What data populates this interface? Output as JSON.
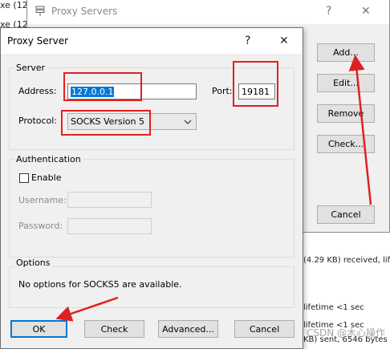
{
  "background": {
    "log_left": [
      "xe (12",
      "xe (12"
    ],
    "window": {
      "title": "Proxy Servers",
      "help": "?",
      "close": "✕",
      "buttons": {
        "add": "Add...",
        "edit": "Edit...",
        "remove": "Remove",
        "check": "Check...",
        "cancel": "Cancel"
      }
    },
    "log_right": [
      "(4.29 KB) received, lifet",
      "lifetime <1 sec",
      "lifetime <1 sec",
      "KB) sent, 6546 bytes (6"
    ]
  },
  "dialog": {
    "title": "Proxy Server",
    "help": "?",
    "close": "✕",
    "server": {
      "legend": "Server",
      "address_label": "Address:",
      "address_value": "127.0.0.1",
      "port_label": "Port:",
      "port_value": "19181",
      "protocol_label": "Protocol:",
      "protocol_value": "SOCKS Version 5"
    },
    "authentication": {
      "legend": "Authentication",
      "enable_label": "Enable",
      "enable_checked": false,
      "username_label": "Username:",
      "password_label": "Password:"
    },
    "options": {
      "legend": "Options",
      "text": "No options for SOCKS5 are available."
    },
    "buttons": {
      "ok": "OK",
      "check": "Check",
      "advanced": "Advanced...",
      "cancel": "Cancel"
    }
  },
  "watermark": "CSDN @木心操作",
  "colors": {
    "annotation": "#e02020",
    "accent": "#0078d7"
  }
}
